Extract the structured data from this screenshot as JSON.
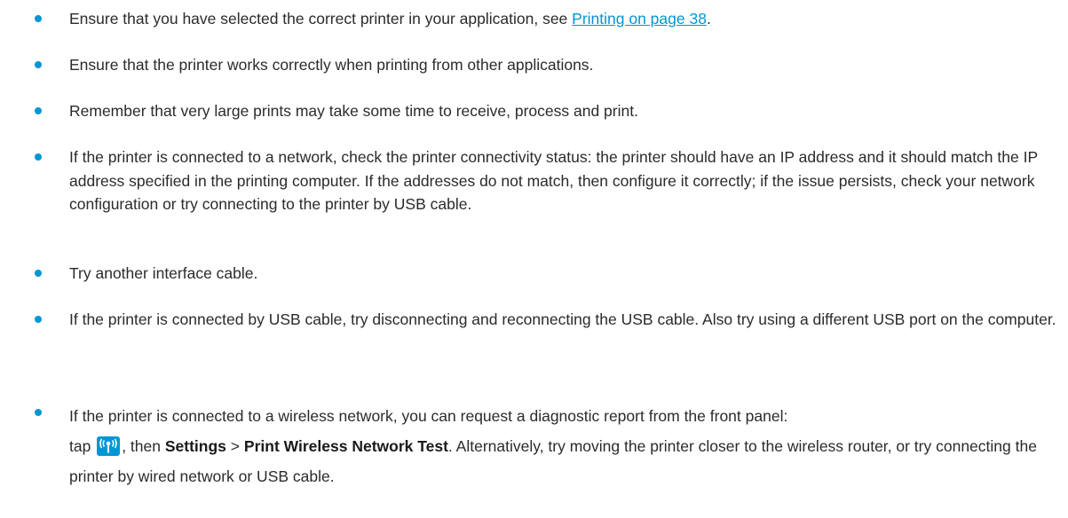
{
  "bullets": [
    {
      "before": "Ensure that you have selected the correct printer in your application, see ",
      "link": "Printing on page 38",
      "after": "."
    },
    {
      "text": "Ensure that the printer works correctly when printing from other applications."
    },
    {
      "text": "Remember that very large prints may take some time to receive, process and print."
    },
    {
      "text": "If the printer is connected to a network, check the printer connectivity status: the printer should have an IP address and it should match the IP address specified in the printing computer. If the addresses do not match, then configure it correctly; if the issue persists, check your network configuration or try connecting to the printer by USB cable."
    },
    {
      "text": "Try another interface cable."
    },
    {
      "text": "If the printer is connected by USB cable, try disconnecting and reconnecting the USB cable. Also try using a different USB port on the computer."
    },
    {
      "line1": "If the printer is connected to a wireless network, you can request a diagnostic report from the front panel:",
      "tap": "tap",
      "then": ", then",
      "settings": "Settings",
      "gt": ">",
      "test": "Print Wireless Network Test",
      "rest": ". Alternatively, try moving the printer closer to the wireless router, or try connecting the printer by wired network or USB cable.",
      "icon": "wireless-icon"
    }
  ],
  "colors": {
    "bullet": "#0096d6",
    "link": "#0096d6",
    "text": "#2b2b2b",
    "icon_bg": "#0096d6"
  }
}
